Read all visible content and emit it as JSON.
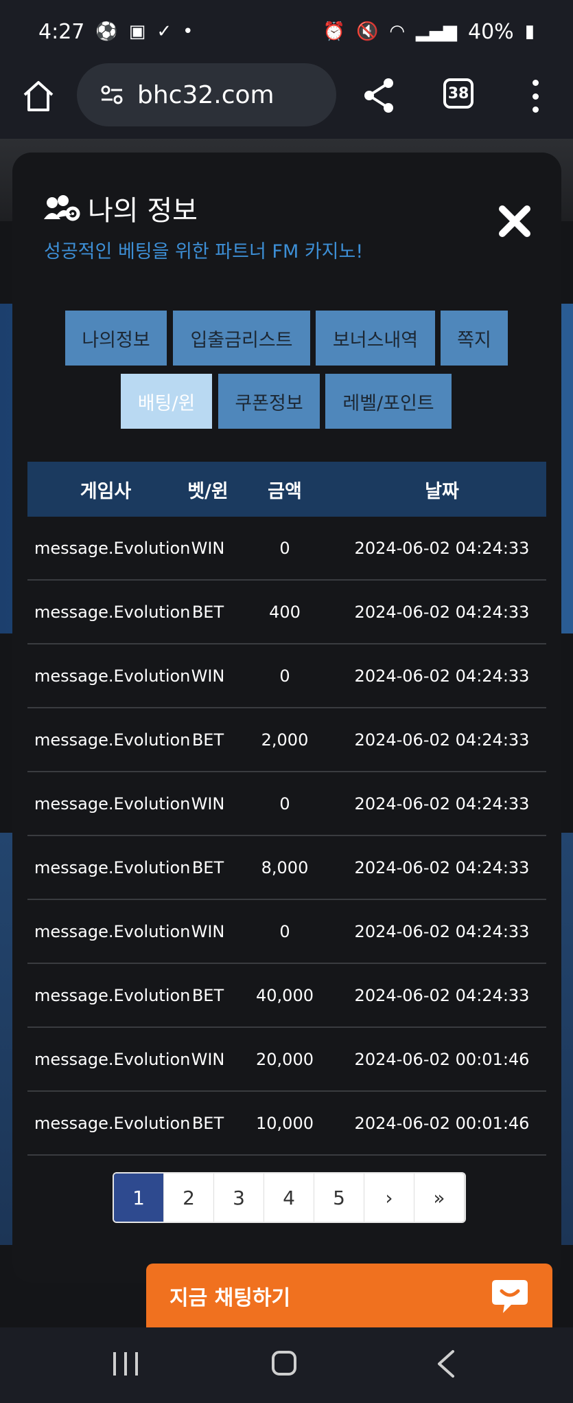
{
  "status": {
    "time": "4:27",
    "battery": "40%"
  },
  "browser": {
    "url": "bhc32.com",
    "tab_count": "38"
  },
  "modal": {
    "title": "나의 정보",
    "subtitle": "성공적인 베팅을 위한 파트너 FM 카지노!",
    "tabs": [
      "나의정보",
      "입출금리스트",
      "보너스내역",
      "쪽지",
      "배팅/윈",
      "쿠폰정보",
      "레벨/포인트"
    ],
    "active_tab": "배팅/윈"
  },
  "table": {
    "headers": [
      "게임사",
      "벳/윈",
      "금액",
      "날짜"
    ],
    "rows": [
      [
        "message.Evolution",
        "WIN",
        "0",
        "2024-06-02 04:24:33"
      ],
      [
        "message.Evolution",
        "BET",
        "400",
        "2024-06-02 04:24:33"
      ],
      [
        "message.Evolution",
        "WIN",
        "0",
        "2024-06-02 04:24:33"
      ],
      [
        "message.Evolution",
        "BET",
        "2,000",
        "2024-06-02 04:24:33"
      ],
      [
        "message.Evolution",
        "WIN",
        "0",
        "2024-06-02 04:24:33"
      ],
      [
        "message.Evolution",
        "BET",
        "8,000",
        "2024-06-02 04:24:33"
      ],
      [
        "message.Evolution",
        "WIN",
        "0",
        "2024-06-02 04:24:33"
      ],
      [
        "message.Evolution",
        "BET",
        "40,000",
        "2024-06-02 04:24:33"
      ],
      [
        "message.Evolution",
        "WIN",
        "20,000",
        "2024-06-02 00:01:46"
      ],
      [
        "message.Evolution",
        "BET",
        "10,000",
        "2024-06-02 00:01:46"
      ]
    ]
  },
  "pagination": {
    "pages": [
      "1",
      "2",
      "3",
      "4",
      "5",
      "›",
      "»"
    ],
    "current": "1"
  },
  "chat": {
    "label": "지금 채팅하기"
  },
  "colors": {
    "accent_blue": "#4f87bb",
    "header_blue": "#1b3a5f",
    "chat_orange": "#f0711f",
    "subtitle_blue": "#3d8fd6"
  }
}
